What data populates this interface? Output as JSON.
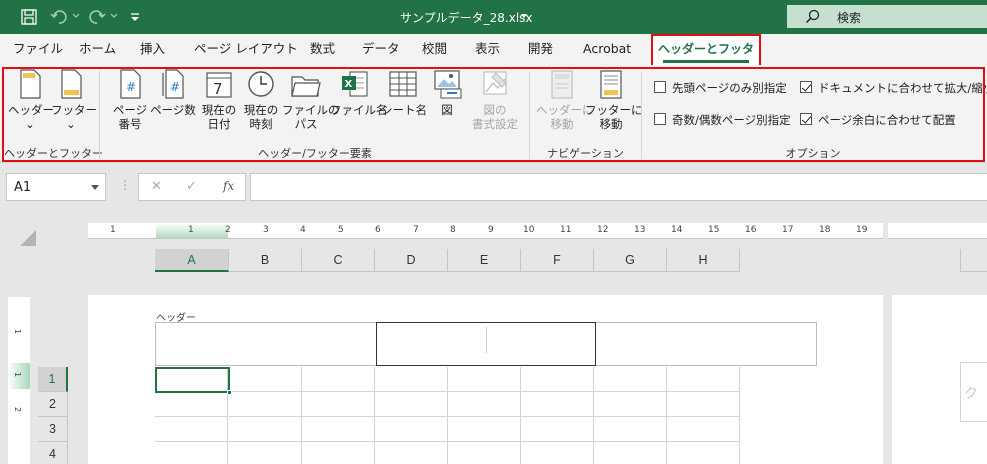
{
  "titlebar": {
    "title": "サンプルデータ_28.xlsx",
    "search_label": "検索"
  },
  "tabs": [
    {
      "label": "ファイル"
    },
    {
      "label": "ホーム"
    },
    {
      "label": "挿入"
    },
    {
      "label": "ページ レイアウト"
    },
    {
      "label": "数式"
    },
    {
      "label": "データ"
    },
    {
      "label": "校閲"
    },
    {
      "label": "表示"
    },
    {
      "label": "開発"
    },
    {
      "label": "Acrobat"
    }
  ],
  "active_tab": "ヘッダーとフッター",
  "ribbon": {
    "group1": {
      "label": "ヘッダーとフッター",
      "header_btn": "ヘッダー",
      "footer_btn": "フッター"
    },
    "group2": {
      "label": "ヘッダー/フッター要素",
      "page_number_1": "ページ",
      "page_number_2": "番号",
      "page_count": "ページ数",
      "current_date_1": "現在の",
      "current_date_2": "日付",
      "current_time_1": "現在の",
      "current_time_2": "時刻",
      "file_path_1": "ファイルの",
      "file_path_2": "パス",
      "file_name": "ファイル名",
      "sheet_name": "シート名",
      "picture": "図",
      "format_picture_1": "図の",
      "format_picture_2": "書式設定"
    },
    "group3": {
      "label": "ナビゲーション",
      "goto_header_1": "ヘッダーに",
      "goto_header_2": "移動",
      "goto_footer_1": "フッターに",
      "goto_footer_2": "移動"
    },
    "group4": {
      "label": "オプション",
      "opt_first_page": "先頭ページのみ別指定",
      "opt_odd_even": "奇数/偶数ページ別指定",
      "opt_scale": "ドキュメントに合わせて拡大/縮小",
      "opt_align": "ページ余白に合わせて配置",
      "opt_first_page_checked": false,
      "opt_odd_even_checked": false,
      "opt_scale_checked": true,
      "opt_align_checked": true
    }
  },
  "formula_bar": {
    "name_box": "A1",
    "fx": "fx",
    "cancel": "✕",
    "enter": "✓",
    "value": ""
  },
  "ruler_numbers": [
    "1",
    "1",
    "2",
    "3",
    "4",
    "5",
    "6",
    "7",
    "8",
    "9",
    "10",
    "11",
    "12",
    "13",
    "14",
    "15",
    "16",
    "17",
    "18",
    "19"
  ],
  "columns": [
    "A",
    "B",
    "C",
    "D",
    "E",
    "F",
    "G",
    "H"
  ],
  "rows": [
    "1",
    "2",
    "3",
    "4"
  ],
  "page": {
    "header_label": "ヘッダー"
  },
  "page2_partial_text": "ク",
  "colors": {
    "excel_green": "#217346",
    "highlight_red": "#e01010"
  }
}
